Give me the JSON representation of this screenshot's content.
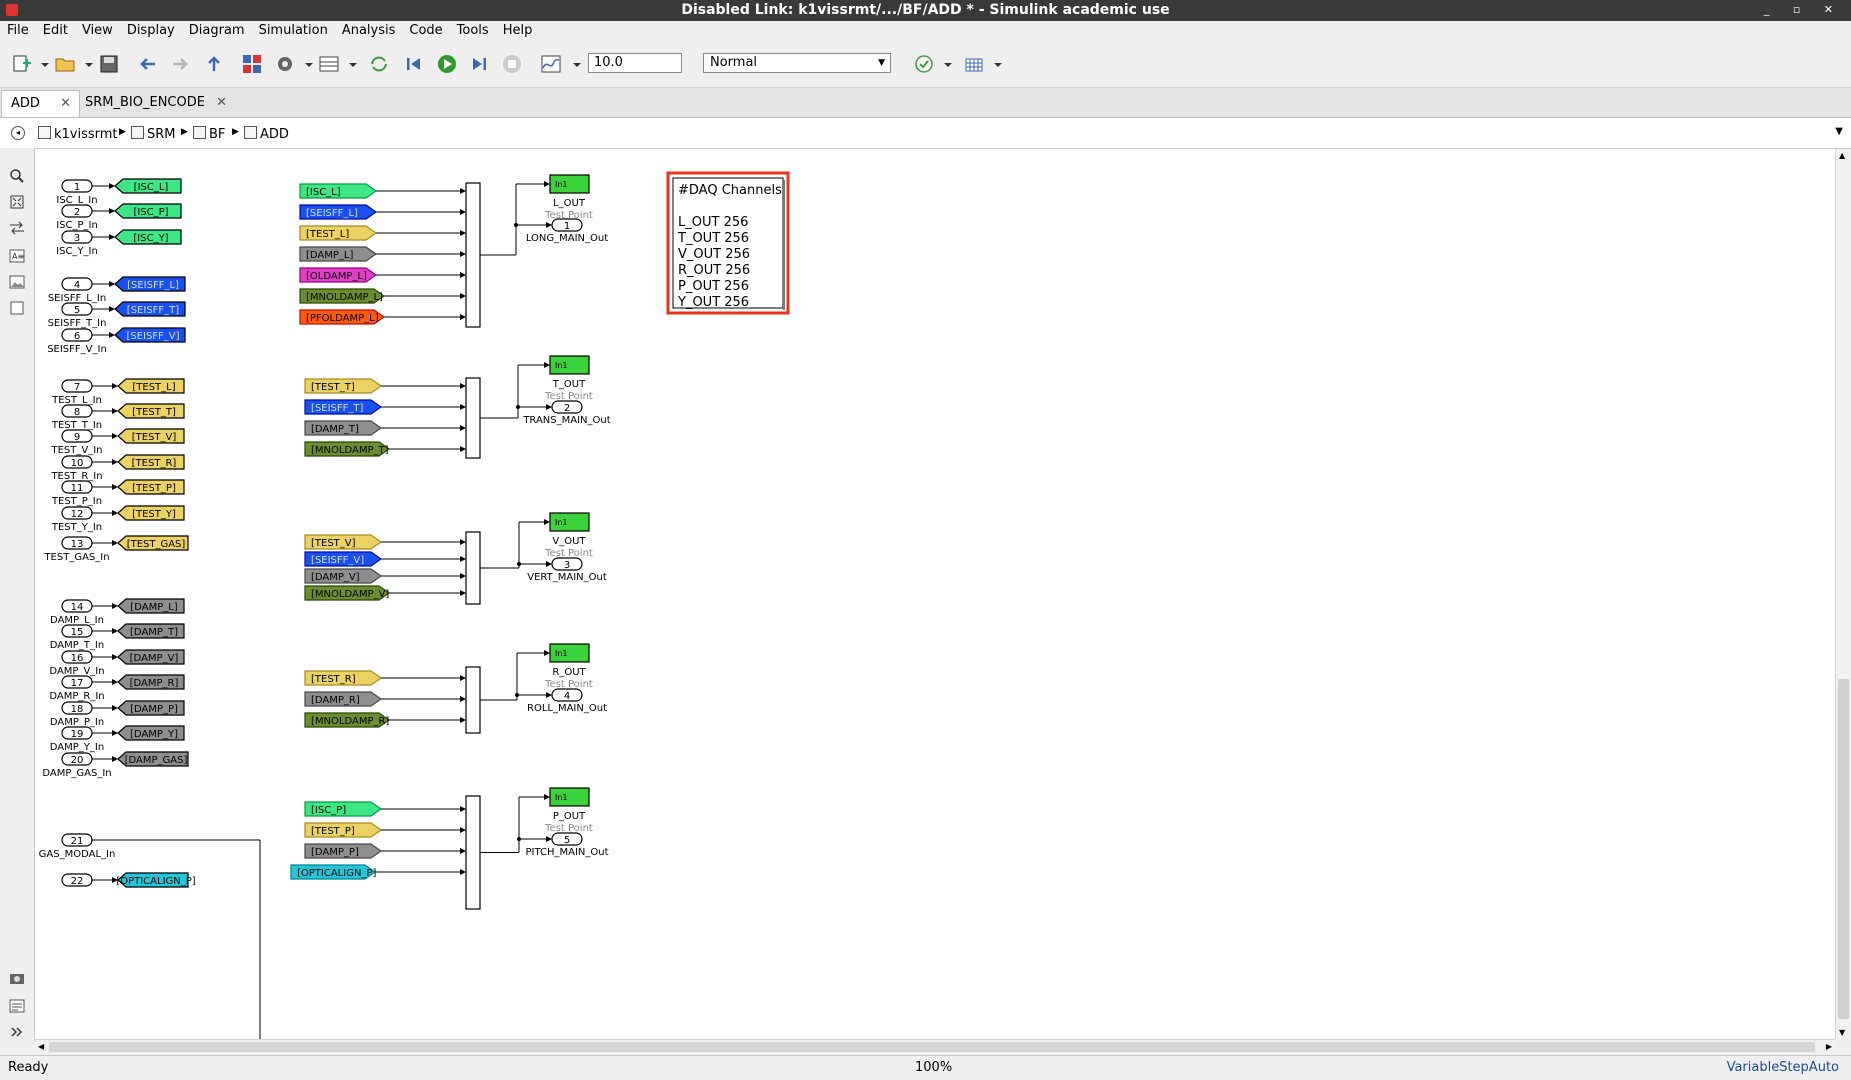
{
  "window": {
    "title": "Disabled Link: k1vissrmt/.../BF/ADD * - Simulink academic use"
  },
  "menu": [
    "File",
    "Edit",
    "View",
    "Display",
    "Diagram",
    "Simulation",
    "Analysis",
    "Code",
    "Tools",
    "Help"
  ],
  "toolbar": {
    "stop_time": "10.0",
    "sim_mode": "Normal"
  },
  "tabs": [
    {
      "label": "ADD"
    },
    {
      "label": "SRM_BIO_ENCODE"
    }
  ],
  "breadcrumb": [
    "k1vissrmt",
    "SRM",
    "BF",
    "ADD"
  ],
  "status": {
    "left": "Ready",
    "zoom": "100%",
    "solver": "VariableStepAuto"
  },
  "colors": {
    "green": "#3ee686",
    "blue": "#1a4ff0",
    "yellow": "#ecd163",
    "gray": "#8e8e8e",
    "magenta": "#e040c8",
    "olive": "#6b8f30",
    "orange": "#ff5a10",
    "cyan": "#22c8d8",
    "testpoint": "#3cd23c",
    "annotation_border": "#e8361a"
  },
  "inports": [
    {
      "num": "1",
      "name": "ISC_L_In",
      "tag": "[ISC_L]",
      "color": "green"
    },
    {
      "num": "2",
      "name": "ISC_P_In",
      "tag": "[ISC_P]",
      "color": "green"
    },
    {
      "num": "3",
      "name": "ISC_Y_In",
      "tag": "[ISC_Y]",
      "color": "green"
    },
    {
      "num": "4",
      "name": "SEISFF_L_In",
      "tag": "[SEISFF_L]",
      "color": "blue"
    },
    {
      "num": "5",
      "name": "SEISFF_T_In",
      "tag": "[SEISFF_T]",
      "color": "blue"
    },
    {
      "num": "6",
      "name": "SEISFF_V_In",
      "tag": "[SEISFF_V]",
      "color": "blue"
    },
    {
      "num": "7",
      "name": "TEST_L_In",
      "tag": "[TEST_L]",
      "color": "yellow"
    },
    {
      "num": "8",
      "name": "TEST_T_In",
      "tag": "[TEST_T]",
      "color": "yellow"
    },
    {
      "num": "9",
      "name": "TEST_V_In",
      "tag": "[TEST_V]",
      "color": "yellow"
    },
    {
      "num": "10",
      "name": "TEST_R_In",
      "tag": "[TEST_R]",
      "color": "yellow"
    },
    {
      "num": "11",
      "name": "TEST_P_In",
      "tag": "[TEST_P]",
      "color": "yellow"
    },
    {
      "num": "12",
      "name": "TEST_Y_In",
      "tag": "[TEST_Y]",
      "color": "yellow"
    },
    {
      "num": "13",
      "name": "TEST_GAS_In",
      "tag": "[TEST_GAS]",
      "color": "yellow"
    },
    {
      "num": "14",
      "name": "DAMP_L_In",
      "tag": "[DAMP_L]",
      "color": "gray"
    },
    {
      "num": "15",
      "name": "DAMP_T_In",
      "tag": "[DAMP_T]",
      "color": "gray"
    },
    {
      "num": "16",
      "name": "DAMP_V_In",
      "tag": "[DAMP_V]",
      "color": "gray"
    },
    {
      "num": "17",
      "name": "DAMP_R_In",
      "tag": "[DAMP_R]",
      "color": "gray"
    },
    {
      "num": "18",
      "name": "DAMP_P_In",
      "tag": "[DAMP_P]",
      "color": "gray"
    },
    {
      "num": "19",
      "name": "DAMP_Y_In",
      "tag": "[DAMP_Y]",
      "color": "gray"
    },
    {
      "num": "20",
      "name": "DAMP_GAS_In",
      "tag": "[DAMP_GAS]",
      "color": "gray"
    },
    {
      "num": "21",
      "name": "GAS_MODAL_In",
      "tag": "",
      "color": ""
    },
    {
      "num": "22",
      "name": "",
      "tag": "[OPTICALIGN_P]",
      "color": "cyan"
    }
  ],
  "groups": [
    {
      "from": [
        {
          "tag": "[ISC_L]",
          "color": "green"
        },
        {
          "tag": "[SEISFF_L]",
          "color": "blue"
        },
        {
          "tag": "[TEST_L]",
          "color": "yellow"
        },
        {
          "tag": "[DAMP_L]",
          "color": "gray"
        },
        {
          "tag": "[OLDAMP_L]",
          "color": "magenta"
        },
        {
          "tag": "[MNOLDAMP_L]",
          "color": "olive"
        },
        {
          "tag": "[PFOLDAMP_L]",
          "color": "orange"
        }
      ],
      "tp_block": "In1",
      "tp_name": "L_OUT",
      "tp_sub": "Test Point",
      "out_num": "1",
      "out_name": "LONG_MAIN_Out"
    },
    {
      "from": [
        {
          "tag": "[TEST_T]",
          "color": "yellow"
        },
        {
          "tag": "[SEISFF_T]",
          "color": "blue"
        },
        {
          "tag": "[DAMP_T]",
          "color": "gray"
        },
        {
          "tag": "[MNOLDAMP_T]",
          "color": "olive"
        }
      ],
      "tp_block": "In1",
      "tp_name": "T_OUT",
      "tp_sub": "Test Point",
      "out_num": "2",
      "out_name": "TRANS_MAIN_Out"
    },
    {
      "from": [
        {
          "tag": "[TEST_V]",
          "color": "yellow"
        },
        {
          "tag": "[SEISFF_V]",
          "color": "blue"
        },
        {
          "tag": "[DAMP_V]",
          "color": "gray"
        },
        {
          "tag": "[MNOLDAMP_V]",
          "color": "olive"
        }
      ],
      "tp_block": "In1",
      "tp_name": "V_OUT",
      "tp_sub": "Test Point",
      "out_num": "3",
      "out_name": "VERT_MAIN_Out"
    },
    {
      "from": [
        {
          "tag": "[TEST_R]",
          "color": "yellow"
        },
        {
          "tag": "[DAMP_R]",
          "color": "gray"
        },
        {
          "tag": "[MNOLDAMP_R]",
          "color": "olive"
        }
      ],
      "tp_block": "In1",
      "tp_name": "R_OUT",
      "tp_sub": "Test Point",
      "out_num": "4",
      "out_name": "ROLL_MAIN_Out"
    },
    {
      "from": [
        {
          "tag": "[ISC_P]",
          "color": "green"
        },
        {
          "tag": "[TEST_P]",
          "color": "yellow"
        },
        {
          "tag": "[DAMP_P]",
          "color": "gray"
        },
        {
          "tag": "[OPTICALIGN_P]",
          "color": "cyan"
        }
      ],
      "tp_block": "In1",
      "tp_name": "P_OUT",
      "tp_sub": "Test Point",
      "out_num": "5",
      "out_name": "PITCH_MAIN_Out"
    }
  ],
  "sum_sign": "+",
  "annotation": {
    "lines": [
      "#DAQ Channels",
      "",
      "L_OUT 256",
      "T_OUT 256",
      "V_OUT 256",
      "R_OUT 256",
      "P_OUT 256",
      "Y_OUT 256"
    ]
  }
}
